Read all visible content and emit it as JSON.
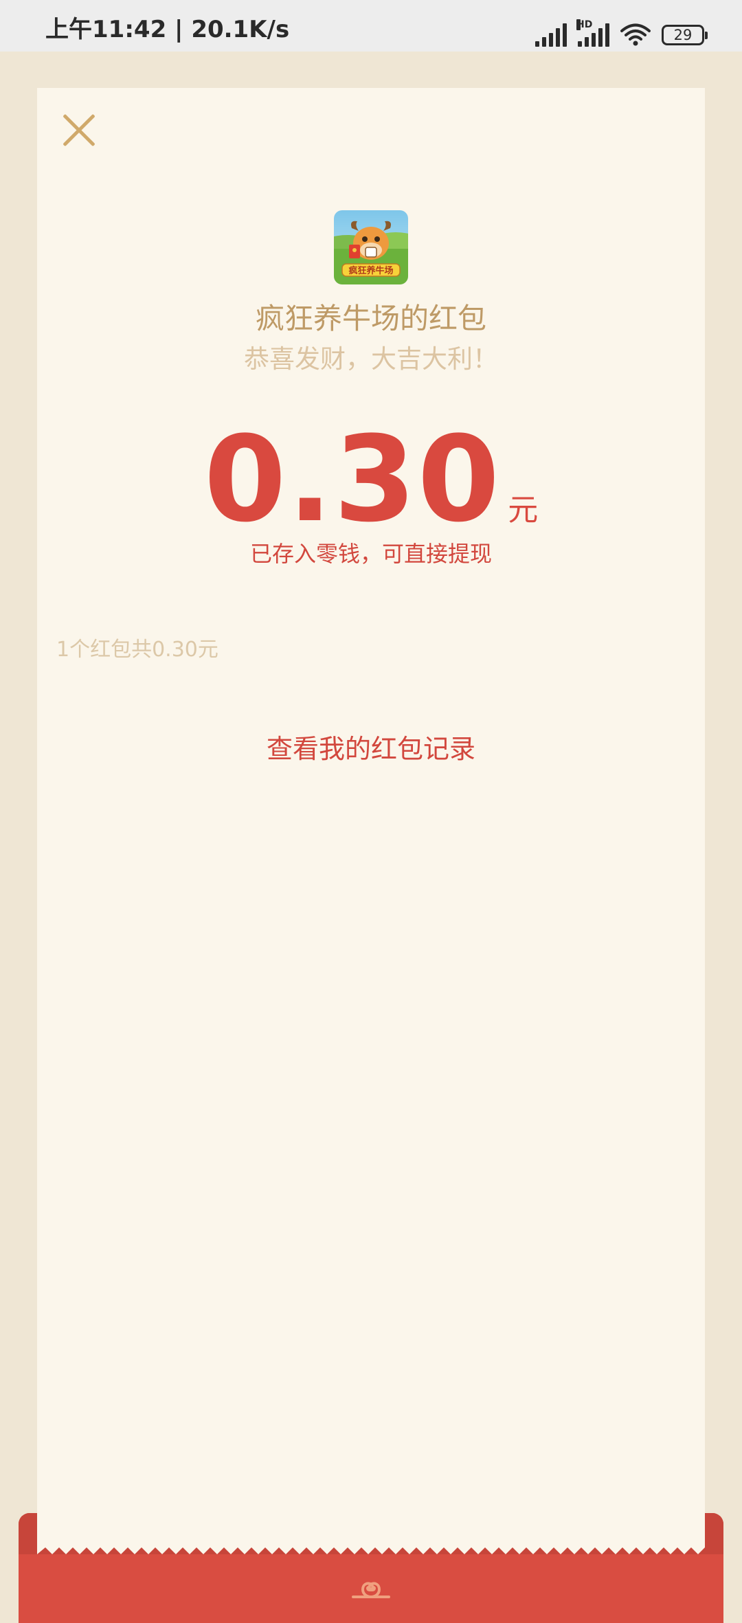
{
  "status_bar": {
    "time": "上午11:42 | 20.1K/s",
    "hd_label": "HD",
    "battery": "29"
  },
  "envelope": {
    "sender_title": "疯狂养牛场的红包",
    "wish": "恭喜发财，大吉大利！",
    "amount": "0.30",
    "unit": "元",
    "deposit_note": "已存入零钱，可直接提现",
    "summary": "1个红包共0.30元",
    "records_link": "查看我的红包记录",
    "app_logo_text": "疯狂养牛场"
  },
  "colors": {
    "accent_red": "#D9493F",
    "gold": "#BE9A66",
    "card_bg": "#FBF6EB",
    "page_bg": "#EFE6D4"
  },
  "icons": [
    "close-icon",
    "signal-icon",
    "wifi-icon",
    "battery-icon",
    "cloud-emblem-icon"
  ]
}
